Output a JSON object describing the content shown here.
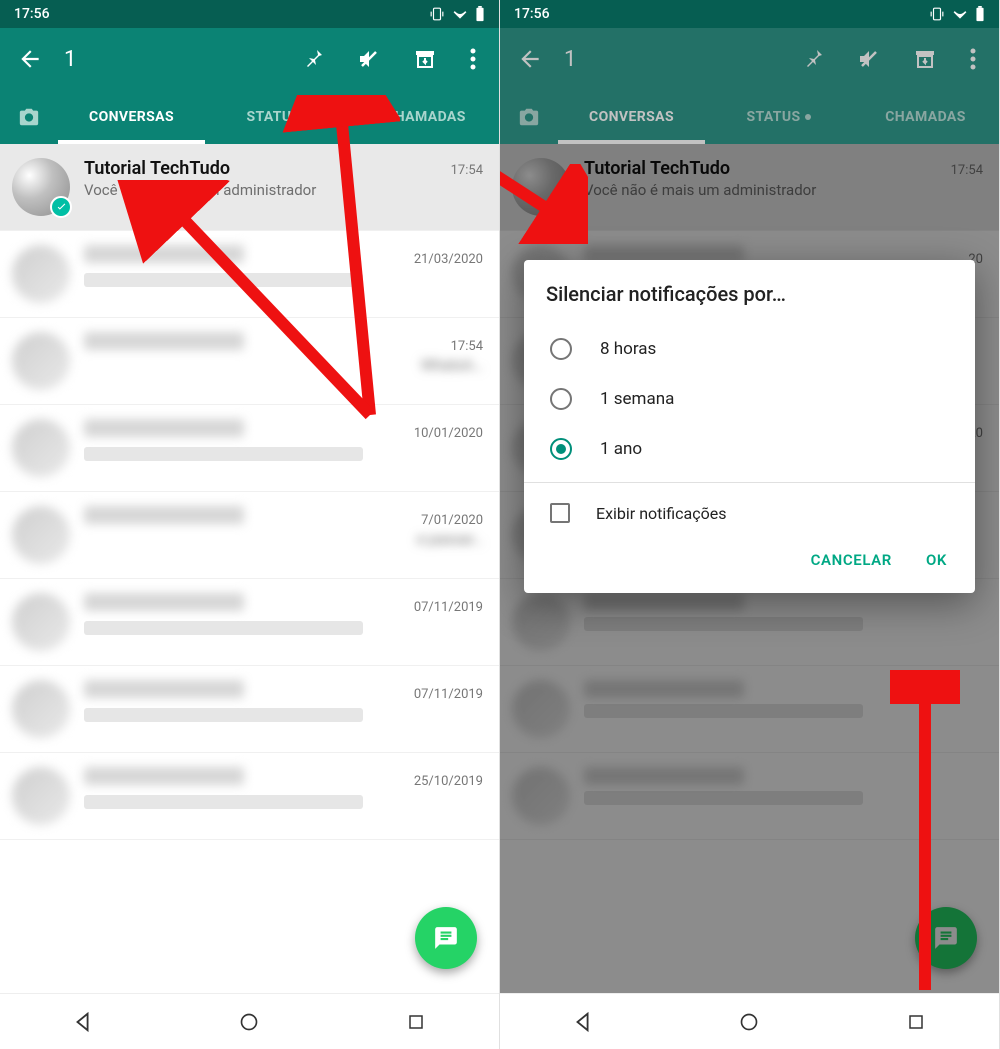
{
  "statusbar": {
    "time": "17:56"
  },
  "toolbar": {
    "selected_count": "1"
  },
  "tabs": {
    "conversas": "CONVERSAS",
    "status": "STATUS",
    "chamadas": "CHAMADAS"
  },
  "chat_selected": {
    "title": "Tutorial TechTudo",
    "message": "Você não é mais um administrador",
    "time": "17:54"
  },
  "chat_list": [
    {
      "time": "21/03/2020",
      "msg": ""
    },
    {
      "time": "17:54",
      "msg": "WhatsA…"
    },
    {
      "time": "10/01/2020",
      "msg": ""
    },
    {
      "time": "7/01/2020",
      "msg": "e passar…"
    },
    {
      "time": "07/11/2019",
      "msg": ""
    },
    {
      "time": "07/11/2019",
      "msg": ""
    },
    {
      "time": "25/10/2019",
      "msg": ""
    }
  ],
  "chat_list_right_extra_time": "20",
  "dialog": {
    "title": "Silenciar notificações por…",
    "options": {
      "opt1": "8 horas",
      "opt2": "1 semana",
      "opt3": "1 ano"
    },
    "checkbox": "Exibir notificações",
    "cancel": "CANCELAR",
    "ok": "OK"
  }
}
